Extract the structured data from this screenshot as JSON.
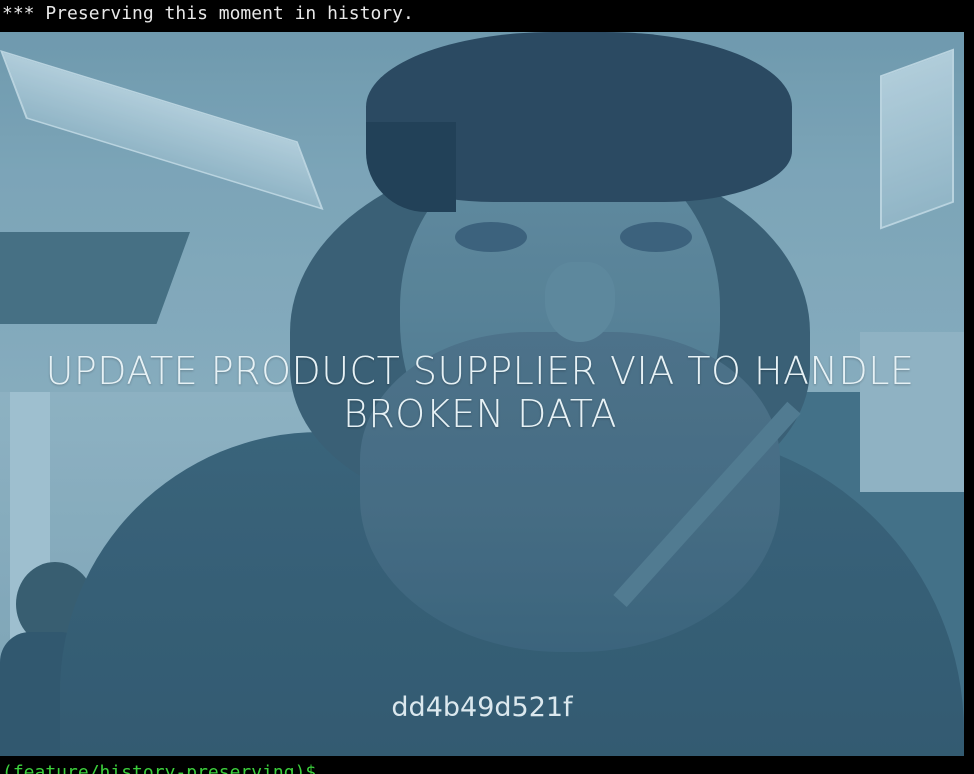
{
  "terminal": {
    "message": "*** Preserving this moment in history.",
    "prompt": "(feature/history-preserving)$"
  },
  "snapshot": {
    "commit_message": "UPDATE PRODUCT SUPPLIER VIA TO HANDLE BROKEN DATA",
    "commit_sha": "dd4b49d521f"
  },
  "colors": {
    "terminal_background": "#000000",
    "terminal_text": "#e8e8e8",
    "prompt_text": "#3cd13c",
    "overlay_tint": "#4a7488",
    "caption_text": "#e6f1f5"
  }
}
